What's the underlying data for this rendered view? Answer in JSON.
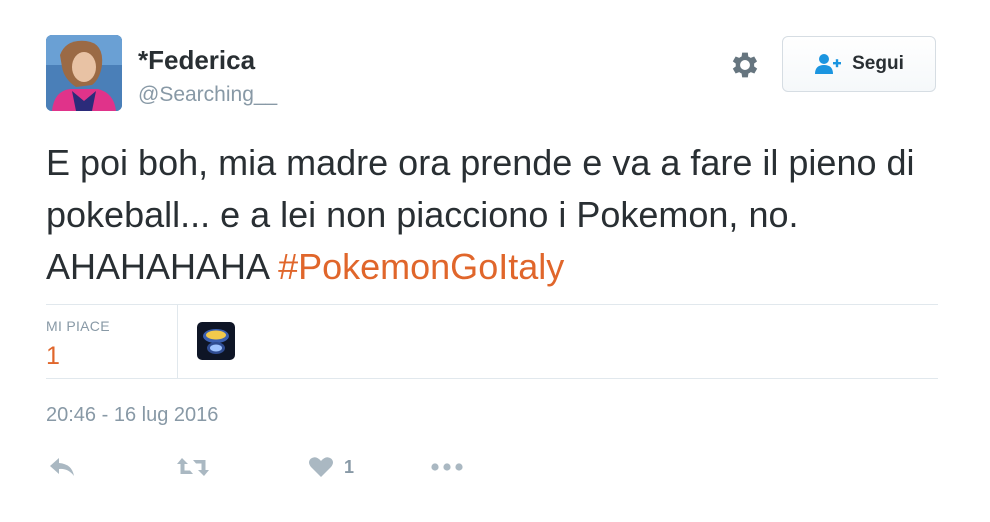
{
  "user": {
    "display_name": "*Federica",
    "handle": "@Searching__"
  },
  "icons": {
    "settings": "gear-icon",
    "follow": "person-add-icon",
    "reply": "reply-icon",
    "retweet": "retweet-icon",
    "like": "heart-icon",
    "more": "more-dots-icon"
  },
  "follow_button": {
    "label": "Segui"
  },
  "tweet": {
    "text": "E poi boh, mia madre ora prende e va a fare il pieno di pokeball... e a lei non piacciono i Pokemon, no. AHAHAHAHA ",
    "hashtag": "#PokemonGoItaly",
    "timestamp": "20:46 - 16 lug 2016"
  },
  "stats": {
    "likes_label": "MI PIACE",
    "likes_count": "1"
  },
  "actions": {
    "like_count": "1"
  },
  "colors": {
    "accent": "#e0662b",
    "text": "#292f33",
    "muted": "#8899a6",
    "follow_icon": "#1b95e0"
  }
}
